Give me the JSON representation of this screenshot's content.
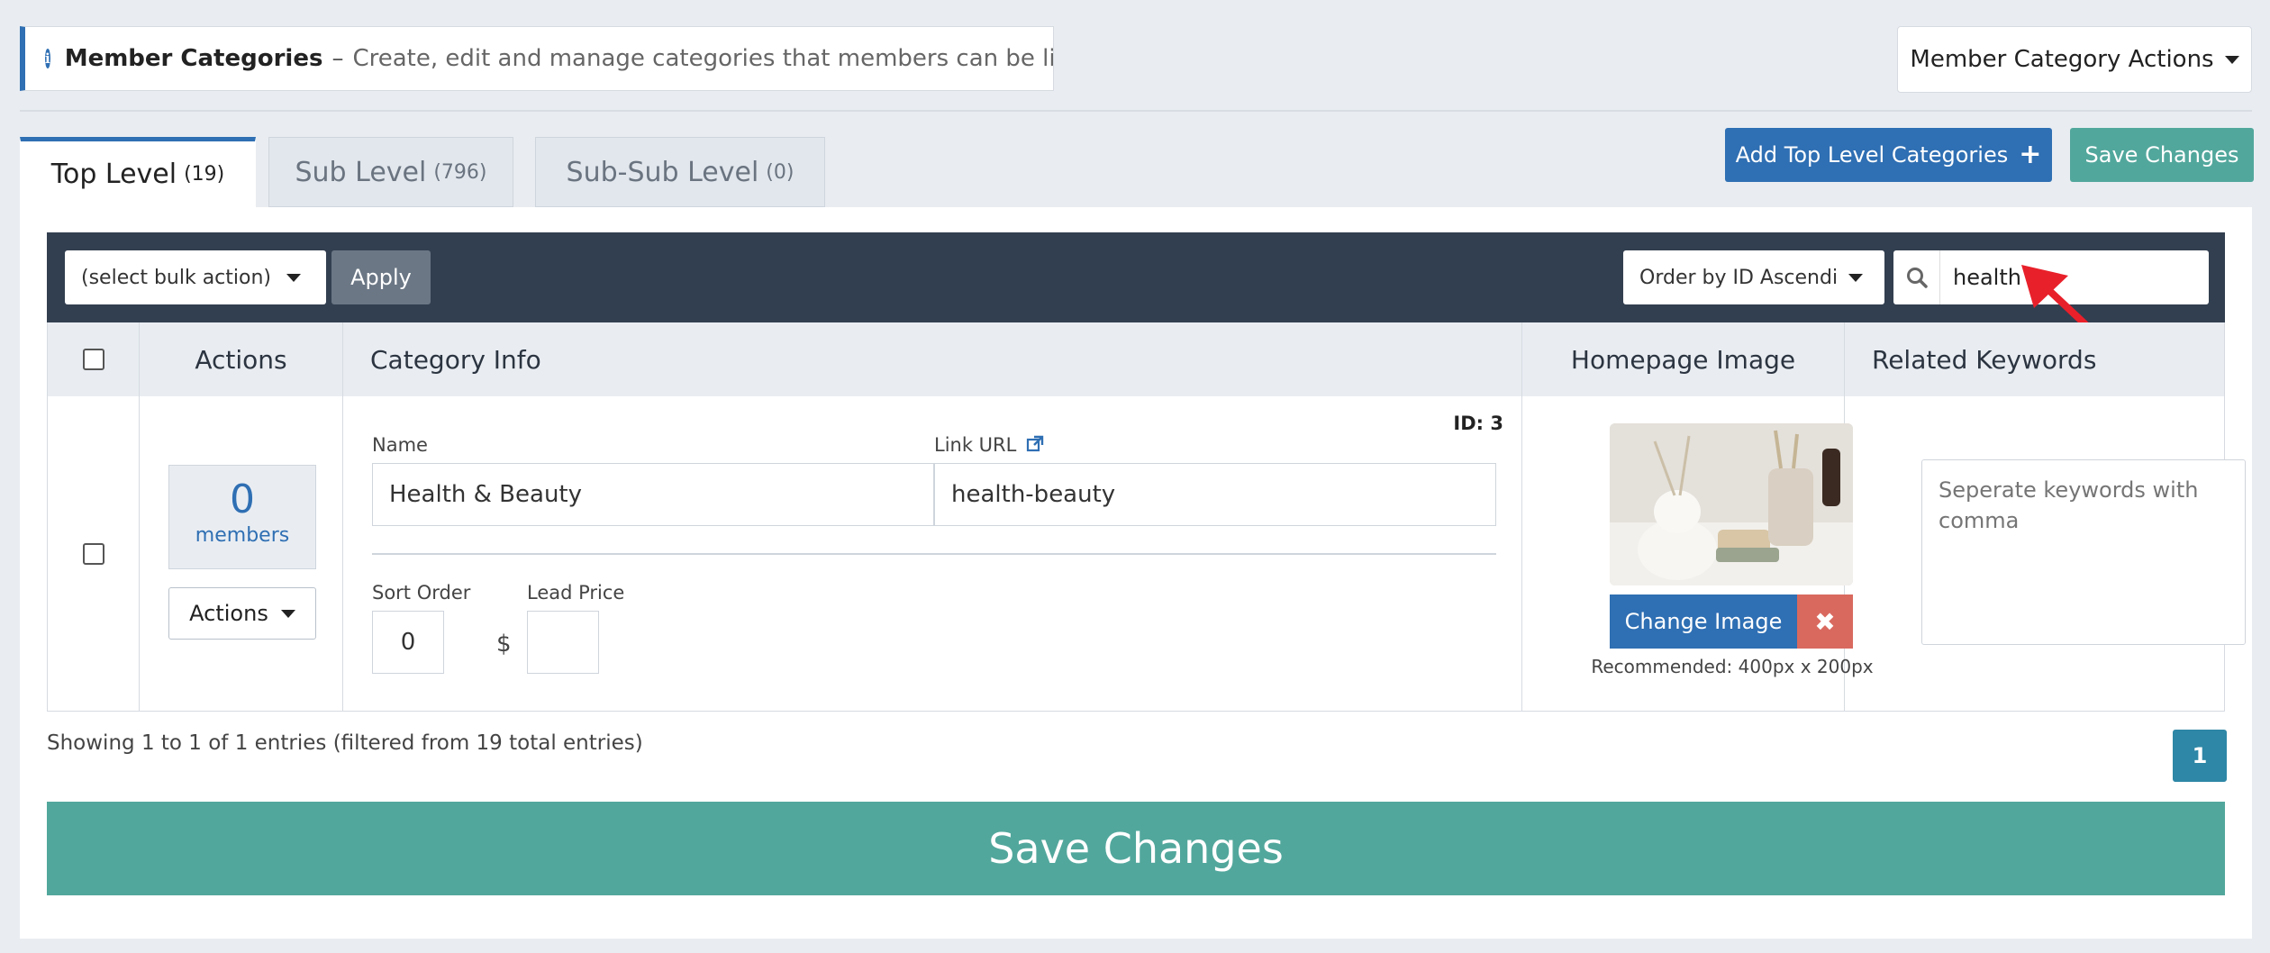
{
  "banner": {
    "title": "Member Categories",
    "separator": "–",
    "description": "Create, edit and manage categories that members can be listed in"
  },
  "header": {
    "member_category_actions": "Member Category Actions"
  },
  "tabs": [
    {
      "label": "Top Level",
      "count": "(19)"
    },
    {
      "label": "Sub Level",
      "count": "(796)"
    },
    {
      "label": "Sub-Sub Level",
      "count": "(0)"
    }
  ],
  "toolbar_buttons": {
    "add_top_level": "Add Top Level Categories",
    "save_changes": "Save Changes"
  },
  "filters": {
    "bulk_action": "(select bulk action)",
    "apply": "Apply",
    "order_by": "Order by ID Ascending",
    "search_value": "health"
  },
  "table": {
    "headers": {
      "actions": "Actions",
      "category_info": "Category Info",
      "homepage_image": "Homepage Image",
      "related_keywords": "Related Keywords"
    },
    "row": {
      "members_count": "0",
      "members_label": "members",
      "actions_label": "Actions",
      "id_label": "ID: 3",
      "name_label": "Name",
      "name_value": "Health & Beauty",
      "link_url_label": "Link URL",
      "link_url_value": "health-beauty",
      "sort_order_label": "Sort Order",
      "sort_order_value": "0",
      "lead_price_label": "Lead Price",
      "currency": "$",
      "lead_price_value": "",
      "change_image": "Change Image",
      "image_recommendation": "Recommended: 400px x 200px",
      "keywords_placeholder": "Seperate keywords with comma"
    }
  },
  "footer": {
    "showing": "Showing 1 to 1 of 1 entries (filtered from 19 total entries)",
    "page": "1",
    "save_changes": "Save Changes"
  },
  "colors": {
    "primary": "#2f6fb3",
    "teal": "#52a79c",
    "toolbar": "#323f50",
    "danger": "#d9695f",
    "annotation_arrow": "#e8202a"
  }
}
